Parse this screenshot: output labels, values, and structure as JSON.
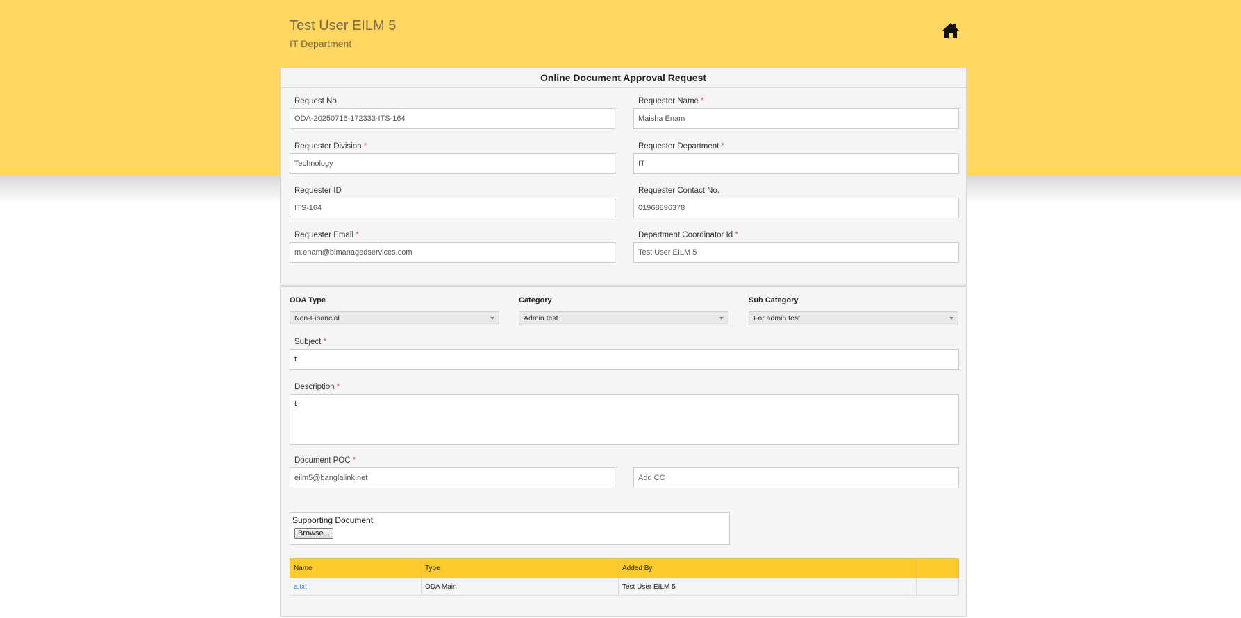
{
  "header": {
    "user_name": "Test User EILM 5",
    "department": "IT Department",
    "home_icon": "home-icon"
  },
  "form": {
    "title": "Online Document Approval Request",
    "request_no": {
      "label": "Request No",
      "value": "ODA-20250716-172333-ITS-164"
    },
    "requester_name": {
      "label": "Requester Name",
      "value": "Maisha Enam"
    },
    "requester_division": {
      "label": "Requester Division",
      "value": "Technology"
    },
    "requester_department": {
      "label": "Requester Department",
      "value": "IT"
    },
    "requester_id": {
      "label": "Requester ID",
      "value": "ITS-164"
    },
    "requester_contact": {
      "label": "Requester Contact No.",
      "value": "01968896378"
    },
    "requester_email": {
      "label": "Requester Email",
      "value": "m.enam@blmanagedservices.com"
    },
    "dept_coordinator": {
      "label": "Department Coordinator Id",
      "value": "Test User EILM 5"
    },
    "required_mark": "*"
  },
  "details": {
    "oda_type": {
      "label": "ODA Type",
      "value": "Non-Financial"
    },
    "category": {
      "label": "Category",
      "value": "Admin test"
    },
    "sub_category": {
      "label": "Sub Category",
      "value": "For admin test"
    },
    "subject": {
      "label": "Subject",
      "value": "t"
    },
    "description": {
      "label": "Description",
      "value": "t"
    },
    "document_poc": {
      "label": "Document POC",
      "value": "eilm5@banglalink.net"
    },
    "add_cc": {
      "placeholder": "Add CC"
    },
    "supporting_document": {
      "label": "Supporting Document",
      "browse_label": "Browse..."
    }
  },
  "documents_table": {
    "headers": [
      "Name",
      "Type",
      "Added By",
      ""
    ],
    "rows": [
      {
        "name": "a.txt",
        "type": "ODA Main",
        "added_by": "Test User EILM 5",
        "action": ""
      }
    ]
  },
  "colors": {
    "banner": "#ffd65f",
    "table_header": "#fcca2a",
    "required": "#d9534f",
    "link": "#3a7bc8"
  }
}
